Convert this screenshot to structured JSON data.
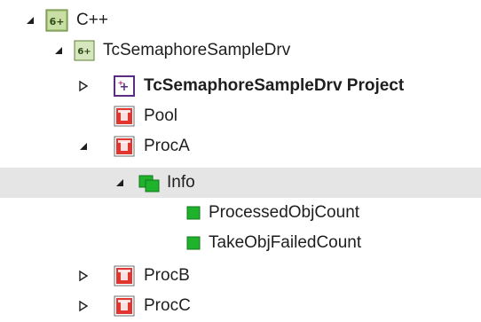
{
  "tree": {
    "root": {
      "label": "C++",
      "icon": "cpp-project-icon",
      "expanded": true
    },
    "driver": {
      "label": "TcSemaphoreSampleDrv",
      "icon": "cpp-module-icon",
      "expanded": true
    },
    "project": {
      "label": "TcSemaphoreSampleDrv Project",
      "icon": "vc-project-icon",
      "expanded": false
    },
    "pool": {
      "label": "Pool",
      "icon": "module-instance-icon"
    },
    "proca": {
      "label": "ProcA",
      "icon": "module-instance-icon",
      "expanded": true
    },
    "info": {
      "label": "Info",
      "icon": "data-area-icon",
      "expanded": true,
      "selected": true
    },
    "processed": {
      "label": "ProcessedObjCount",
      "icon": "variable-icon"
    },
    "takefailed": {
      "label": "TakeObjFailedCount",
      "icon": "variable-icon"
    },
    "procb": {
      "label": "ProcB",
      "icon": "module-instance-icon",
      "expanded": false
    },
    "procc": {
      "label": "ProcC",
      "icon": "module-instance-icon",
      "expanded": false
    }
  },
  "colors": {
    "selection": "#e5e5e5",
    "module_red": "#e0362f",
    "variable_green": "#1fb32c",
    "cpp_green": "#a6c77a"
  }
}
